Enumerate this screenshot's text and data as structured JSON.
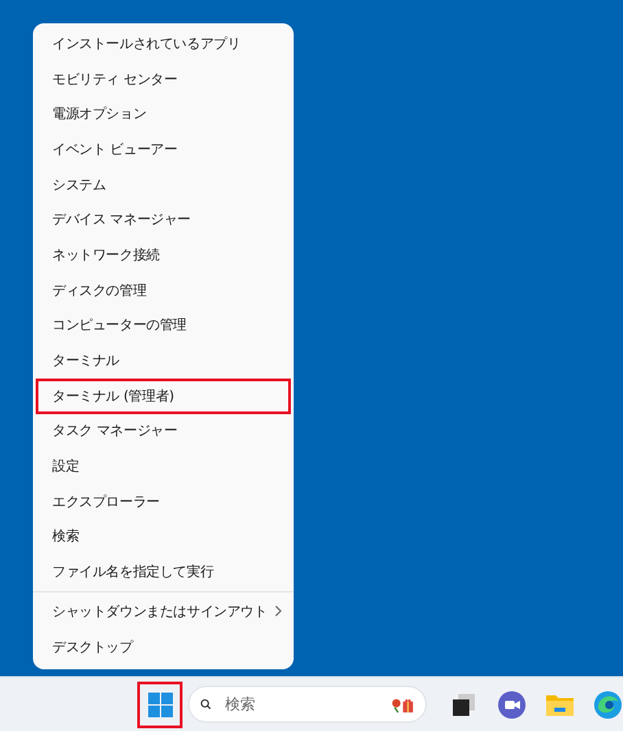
{
  "menu": {
    "groups": [
      {
        "items": [
          {
            "label": "インストールされているアプリ",
            "highlighted": false,
            "submenu": false
          },
          {
            "label": "モビリティ センター",
            "highlighted": false,
            "submenu": false
          },
          {
            "label": "電源オプション",
            "highlighted": false,
            "submenu": false
          },
          {
            "label": "イベント ビューアー",
            "highlighted": false,
            "submenu": false
          },
          {
            "label": "システム",
            "highlighted": false,
            "submenu": false
          },
          {
            "label": "デバイス マネージャー",
            "highlighted": false,
            "submenu": false
          },
          {
            "label": "ネットワーク接続",
            "highlighted": false,
            "submenu": false
          },
          {
            "label": "ディスクの管理",
            "highlighted": false,
            "submenu": false
          },
          {
            "label": "コンピューターの管理",
            "highlighted": false,
            "submenu": false
          },
          {
            "label": "ターミナル",
            "highlighted": false,
            "submenu": false
          },
          {
            "label": "ターミナル (管理者)",
            "highlighted": true,
            "submenu": false
          },
          {
            "label": "タスク マネージャー",
            "highlighted": false,
            "submenu": false
          },
          {
            "label": "設定",
            "highlighted": false,
            "submenu": false
          },
          {
            "label": "エクスプローラー",
            "highlighted": false,
            "submenu": false
          },
          {
            "label": "検索",
            "highlighted": false,
            "submenu": false
          },
          {
            "label": "ファイル名を指定して実行",
            "highlighted": false,
            "submenu": false
          }
        ]
      },
      {
        "items": [
          {
            "label": "シャットダウンまたはサインアウト",
            "highlighted": false,
            "submenu": true
          },
          {
            "label": "デスクトップ",
            "highlighted": false,
            "submenu": false
          }
        ]
      }
    ]
  },
  "taskbar": {
    "start_button": {
      "highlighted": true
    },
    "search": {
      "placeholder": "検索"
    },
    "apps": [
      {
        "kind": "taskview"
      },
      {
        "kind": "chat"
      },
      {
        "kind": "folder"
      },
      {
        "kind": "browser"
      }
    ]
  }
}
